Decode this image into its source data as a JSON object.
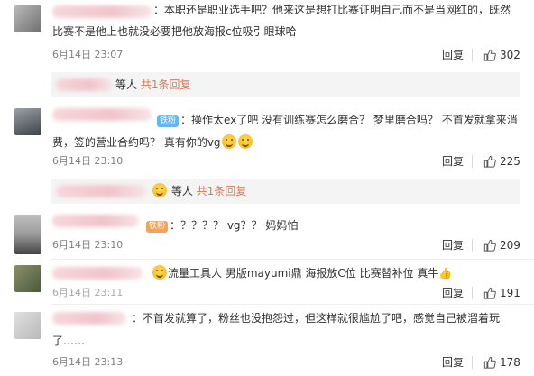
{
  "comments": [
    {
      "line1": "：本职还是职业选手吧？他来这是想打比赛证明自己而不是当网红的，既然",
      "line2": "比赛不是他上也就没必要把他放海报c位吸引眼球哈",
      "time": "6月14日 23:07",
      "reply": "回复",
      "likes": "302"
    },
    {
      "badge": "铁粉",
      "line1": "：操作太ex了吧 没有训练赛怎么磨合？ 梦里磨合吗？ 不首发就拿来消",
      "line2": "费，签的营业合约吗？ 真有你的vg",
      "time": "6月14日 23:10",
      "reply": "回复",
      "likes": "225"
    },
    {
      "badge": "铁粉",
      "line1": "：？？？？ vg？？ 妈妈怕",
      "time": "6月14日 23:10",
      "reply": "回复",
      "likes": "209"
    },
    {
      "line1": "流量工具人 男版mayumi鼎 海报放C位 比赛替补位 真牛",
      "time": "6月14日 23:11",
      "reply": "回复",
      "likes": "191"
    },
    {
      "line1": "：不首发就算了，粉丝也没抱怨过，但这样就很尴尬了吧，感觉自己被溜着玩",
      "line2": "了……",
      "time": "6月14日 23:13",
      "reply": "回复",
      "likes": "178"
    }
  ],
  "subreplies": [
    {
      "prefix": "等人",
      "link": "共1条回复"
    },
    {
      "prefix": "等人",
      "link": "共1条回复"
    }
  ],
  "colors": {
    "link": "#eb7350",
    "meta": "#808080",
    "badge": "#63b7f2"
  }
}
